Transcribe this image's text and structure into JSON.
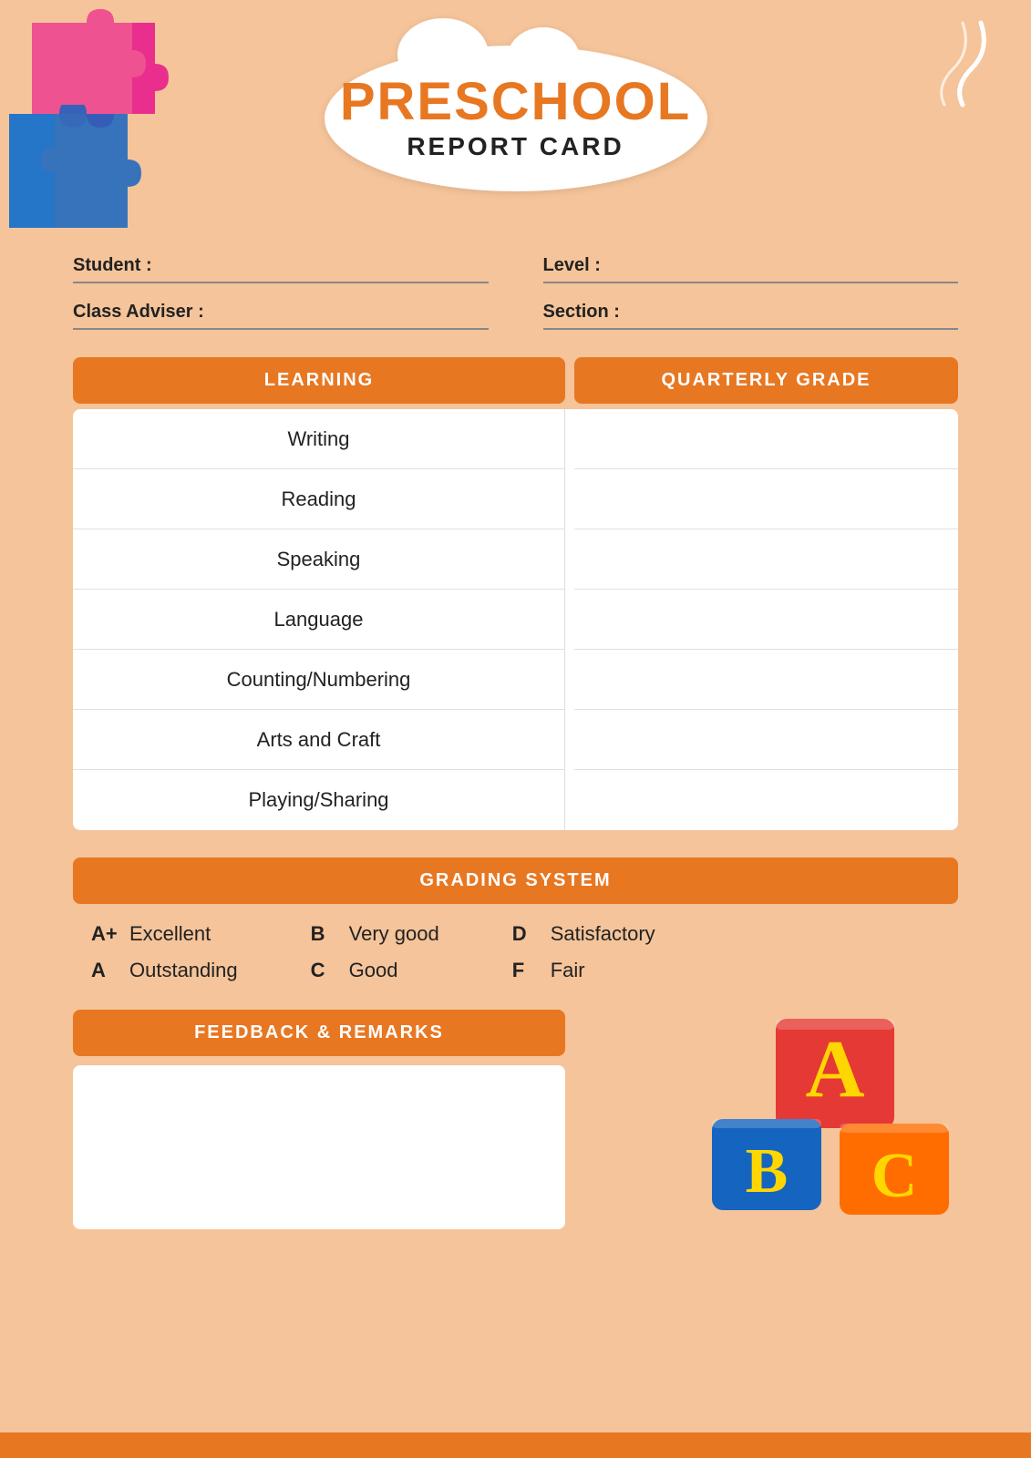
{
  "title": {
    "preschool": "PRESCHOOL",
    "report_card": "REPORT CARD"
  },
  "student_info": {
    "student_label": "Student :",
    "level_label": "Level :",
    "adviser_label": "Class Adviser :",
    "section_label": "Section :"
  },
  "table": {
    "learning_header": "LEARNING",
    "quarterly_header": "QUARTERLY GRADE",
    "subjects": [
      {
        "name": "Writing"
      },
      {
        "name": "Reading"
      },
      {
        "name": "Speaking"
      },
      {
        "name": "Language"
      },
      {
        "name": "Counting/Numbering"
      },
      {
        "name": "Arts and Craft"
      },
      {
        "name": "Playing/Sharing"
      }
    ]
  },
  "grading": {
    "header": "GRADING SYSTEM",
    "items": [
      {
        "letter": "A+",
        "desc": "Excellent"
      },
      {
        "letter": "A",
        "desc": "Outstanding"
      },
      {
        "letter": "B",
        "desc": "Very good"
      },
      {
        "letter": "C",
        "desc": "Good"
      },
      {
        "letter": "D",
        "desc": "Satisfactory"
      },
      {
        "letter": "F",
        "desc": "Fair"
      }
    ]
  },
  "feedback": {
    "header": "FEEDBACK & REMARKS"
  },
  "colors": {
    "orange": "#E87722",
    "background": "#F5C49A",
    "white": "#FFFFFF"
  }
}
